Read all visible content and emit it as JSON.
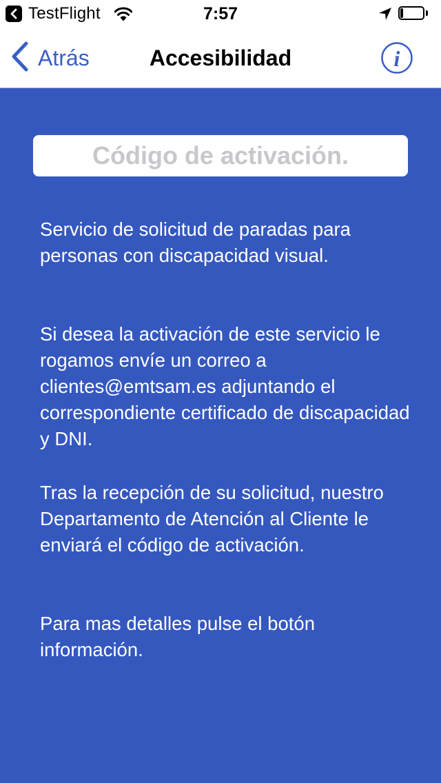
{
  "status_bar": {
    "back_app": "TestFlight",
    "time": "7:57",
    "battery_level": 0.12
  },
  "nav": {
    "back_label": "Atrás",
    "title": "Accesibilidad",
    "info_icon_glyph": "i"
  },
  "activation": {
    "value": "",
    "placeholder": "Código de activación."
  },
  "body": {
    "paragraphs": [
      "Servicio de solicitud de paradas para personas con discapacidad visual.",
      "Si desea la activación de este servicio le rogamos envíe un correo a clientes@emtsam.es adjuntando el correspondiente certificado de discapacidad y DNI.",
      "Tras la recepción de su solicitud, nuestro Departamento de Atención al Cliente le enviará el código de activación.",
      "Para mas detalles pulse el botón información."
    ]
  },
  "colors": {
    "background": "#3558bf",
    "accent": "#3a5fc4",
    "bar_background": "#ffffff",
    "text_on_background": "#ffffff",
    "placeholder": "#c7c7cc"
  },
  "icons": {
    "status_back": "back-to-app-icon",
    "wifi": "wifi-icon",
    "location": "location-arrow-icon",
    "battery": "battery-icon",
    "nav_back": "chevron-left-icon",
    "info": "info-icon"
  }
}
